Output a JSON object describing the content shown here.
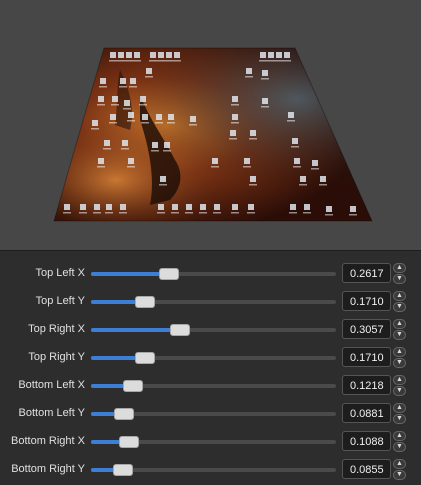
{
  "preview": {
    "image": "nebula-desktop-screenshot",
    "transform": "perspective-corner-pin"
  },
  "controls": [
    {
      "label": "Top Left X",
      "value": "0.2617",
      "level": 0.2617
    },
    {
      "label": "Top Left Y",
      "value": "0.1710",
      "level": 0.171
    },
    {
      "label": "Top Right X",
      "value": "0.3057",
      "level": 0.3057
    },
    {
      "label": "Top Right Y",
      "value": "0.1710",
      "level": 0.171
    },
    {
      "label": "Bottom Left X",
      "value": "0.1218",
      "level": 0.1218
    },
    {
      "label": "Bottom Left Y",
      "value": "0.0881",
      "level": 0.0881
    },
    {
      "label": "Bottom Right X",
      "value": "0.1088",
      "level": 0.1088
    },
    {
      "label": "Bottom Right Y",
      "value": "0.0855",
      "level": 0.0855
    }
  ],
  "icons": {
    "up": "chevron-up-icon",
    "down": "chevron-down-icon"
  },
  "colors": {
    "accent": "#3c7fd4",
    "background": "#2d2d2d",
    "preview_background": "#474747"
  }
}
